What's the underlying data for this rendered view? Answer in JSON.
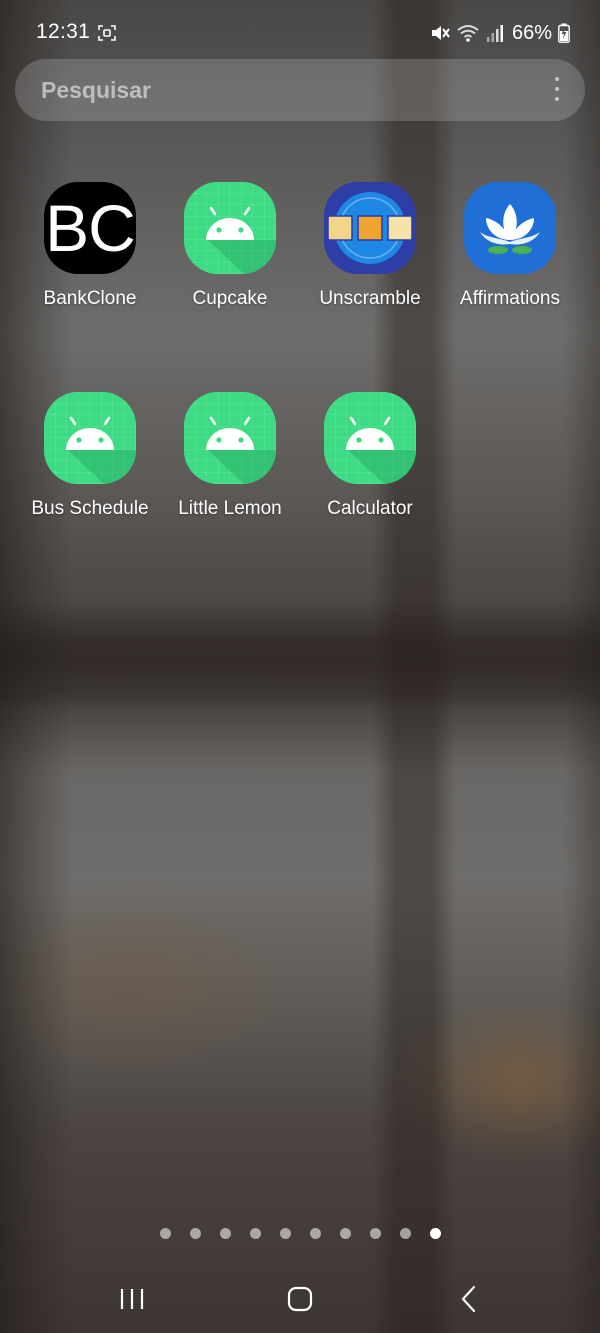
{
  "status_bar": {
    "time": "12:31",
    "battery_percent": "66%",
    "icons": [
      "screen-record-icon",
      "mute-vibrate-icon",
      "wifi-icon",
      "signal-icon",
      "battery-charging-icon"
    ]
  },
  "search": {
    "placeholder": "Pesquisar",
    "menu_icon": "more-vertical-icon"
  },
  "apps": [
    {
      "label": "BankClone",
      "icon": "bankclone-icon",
      "icon_text": "BC"
    },
    {
      "label": "Cupcake",
      "icon": "android-icon"
    },
    {
      "label": "Unscramble",
      "icon": "unscramble-icon"
    },
    {
      "label": "Affirmations",
      "icon": "lotus-icon"
    },
    {
      "label": "Bus Schedule",
      "icon": "android-icon"
    },
    {
      "label": "Little Lemon",
      "icon": "android-icon"
    },
    {
      "label": "Calculator",
      "icon": "android-icon"
    }
  ],
  "page_indicator": {
    "total_pages": 10,
    "active_page": 10
  },
  "nav_bar": {
    "buttons": [
      "recents-icon",
      "home-icon",
      "back-icon"
    ]
  },
  "colors": {
    "android_green": "#3ddc84",
    "unscramble_blue": "#2f3da6",
    "affirmations_blue": "#1f6fd6"
  }
}
